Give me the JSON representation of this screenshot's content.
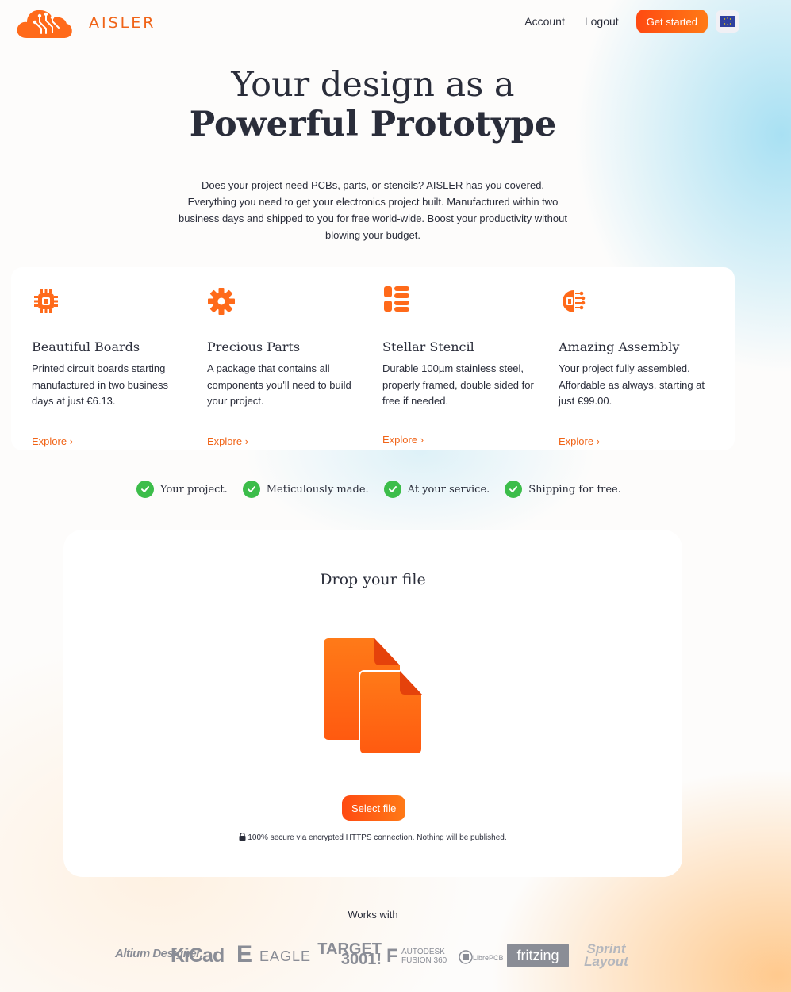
{
  "header": {
    "brand": "AISLER",
    "nav": {
      "account": "Account",
      "logout": "Logout",
      "get_started": "Get started"
    },
    "region_icon": "eu-flag-icon"
  },
  "hero": {
    "title_line1": "Your design as a",
    "title_line2": "Powerful Prototype",
    "description": "Does your project need PCBs, parts, or stencils? AISLER has you covered. Everything you need to get your electronics project built. Manufactured within two business days and shipped to you for free world-wide. Boost your productivity without blowing your budget."
  },
  "features": [
    {
      "icon": "chip-icon",
      "title": "Beautiful Boards",
      "text": "Printed circuit boards starting manufactured in two business days at just €6.13.",
      "link": "Explore ›"
    },
    {
      "icon": "gear-icon",
      "title": "Precious Parts",
      "text": "A package that contains all components you'll need to build your project.",
      "link": "Explore ›"
    },
    {
      "icon": "stencil-icon",
      "title": "Stellar Stencil",
      "text": "Durable 100µm stainless steel, properly framed, double sided for free if needed.",
      "link": "Explore ›"
    },
    {
      "icon": "assembly-icon",
      "title": "Amazing Assembly",
      "text": "Your project fully assembled. Affordable as always, starting at just €99.00.",
      "link": "Explore ›"
    }
  ],
  "checks": [
    "Your project.",
    "Meticulously made.",
    "At your service.",
    "Shipping for free."
  ],
  "upload": {
    "title": "Drop your file",
    "button": "Select file",
    "secure_note": "100% secure via encrypted HTTPS connection. Nothing will be published."
  },
  "works_with": {
    "label": "Works with",
    "tools": [
      "Altium Designer.",
      "KiCad",
      "EAGLE",
      "TARGET 3001!",
      "AUTODESK FUSION 360",
      "LibrePCB",
      "fritzing",
      "Sprint Layout"
    ]
  },
  "colors": {
    "accent": "#f06418",
    "button_start": "#ff4a12",
    "button_end": "#ff7a16",
    "check_green": "#3cbd4a",
    "text": "#2a2d3a"
  }
}
